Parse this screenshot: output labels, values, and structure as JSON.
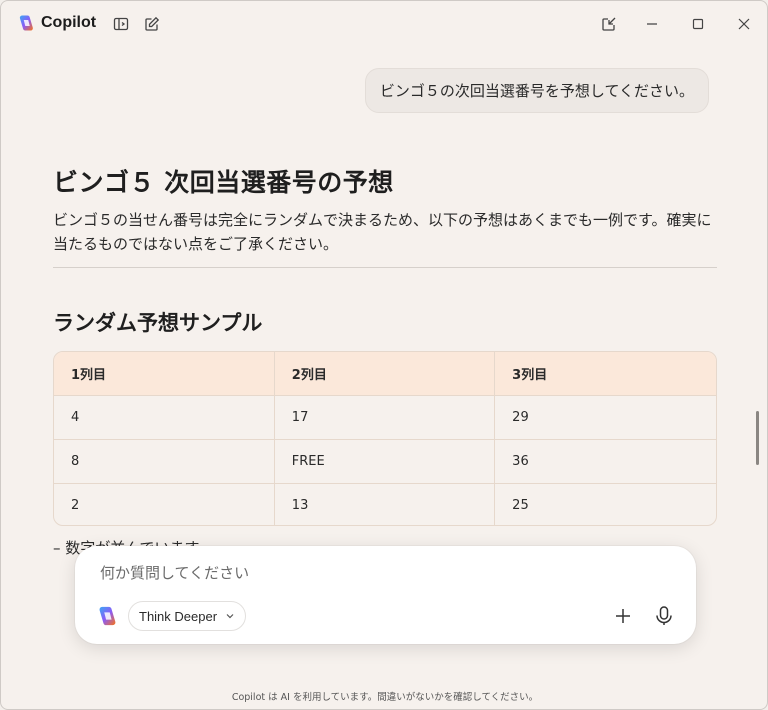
{
  "app": {
    "title": "Copilot"
  },
  "conversation": {
    "user_message": "ビンゴ５の次回当選番号を予想してください。",
    "heading": "ビンゴ５ 次回当選番号の予想",
    "paragraph": "ビンゴ５の当せん番号は完全にランダムで決まるため、以下の予想はあくまでも一例です。確実に当たるものではない点をご了承ください。",
    "section_title": "ランダム予想サンプル",
    "table": {
      "headers": [
        "1列目",
        "2列目",
        "3列目"
      ],
      "rows": [
        [
          "4",
          "17",
          "29"
        ],
        [
          "8",
          "FREE",
          "36"
        ],
        [
          "2",
          "13",
          "25"
        ]
      ]
    },
    "partial_text": "– 数字が並んでいます"
  },
  "composer": {
    "placeholder": "何か質問してください",
    "mode_label": "Think Deeper"
  },
  "footer": {
    "disclaimer": "Copilot は AI を利用しています。間違いがないかを確認してください。"
  },
  "icons": {
    "sidebar": "sidebar-toggle-icon",
    "new_chat": "new-chat-icon",
    "pin": "pin-window-icon",
    "minimize": "minimize-icon",
    "maximize": "maximize-icon",
    "close": "close-icon",
    "plus": "plus-icon",
    "mic": "microphone-icon"
  }
}
